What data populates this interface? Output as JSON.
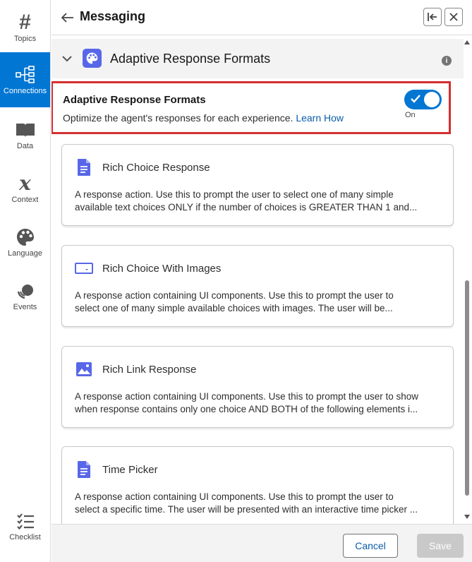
{
  "sidebar": {
    "items": [
      {
        "label": "Topics",
        "icon": "hash-icon"
      },
      {
        "label": "Connections",
        "icon": "connections-icon",
        "active": true
      },
      {
        "label": "Data",
        "icon": "book-icon"
      },
      {
        "label": "Context",
        "icon": "variable-icon"
      },
      {
        "label": "Language",
        "icon": "palette-icon"
      },
      {
        "label": "Events",
        "icon": "events-icon"
      },
      {
        "label": "Checklist",
        "icon": "checklist-icon"
      }
    ]
  },
  "header": {
    "title": "Messaging"
  },
  "section": {
    "title": "Adaptive Response Formats"
  },
  "toggle_panel": {
    "title": "Adaptive Response Formats",
    "description": "Optimize the agent's responses for each experience.",
    "link": "Learn How",
    "state": "On",
    "enabled": true
  },
  "cards": [
    {
      "title": "Rich Choice Response",
      "icon": "document-icon",
      "line1": "A response action. Use this to prompt the user to select one of many simple",
      "line2": "available text choices ONLY if the number of choices is GREATER THAN 1 and..."
    },
    {
      "title": "Rich Choice With Images",
      "icon": "image-frame-icon",
      "line1": "A response action containing UI components. Use this to prompt the user to",
      "line2": "select one of many simple available choices with images. The user will be..."
    },
    {
      "title": "Rich Link Response",
      "icon": "image-icon",
      "line1": "A response action containing UI components. Use this to prompt the user to show",
      "line2": "when response contains only one choice AND BOTH of the following elements i..."
    },
    {
      "title": "Time Picker",
      "icon": "document-icon",
      "line1": "A response action containing UI components. Use this to prompt the user to",
      "line2": "select a specific time. The user will be presented with an interactive time picker ..."
    }
  ],
  "footer": {
    "cancel": "Cancel",
    "save": "Save"
  },
  "colors": {
    "brand": "#0176d3",
    "accent_icon": "#5867e8",
    "highlight": "#d32f2f",
    "link": "#0b5cab"
  }
}
